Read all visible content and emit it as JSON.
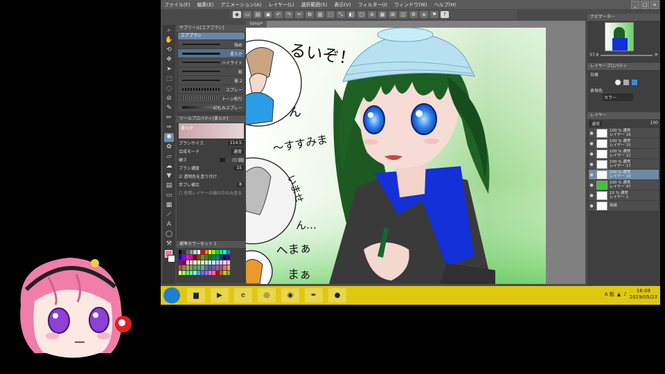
{
  "menu": [
    "ファイル(F)",
    "編集(E)",
    "アニメーション(A)",
    "レイヤー(L)",
    "選択範囲(S)",
    "表示(V)",
    "フィルター(I)",
    "ウィンドウ(W)",
    "ヘルプ(H)"
  ],
  "window_controls": [
    "_",
    "□",
    "×"
  ],
  "subtool": {
    "header": "サブツール[エアブラシ]",
    "tab": "エアブラシ",
    "brushes": [
      "強め",
      "柔らか",
      "ハイライト",
      "影",
      "影 2",
      "スプレー",
      "トーン削り",
      "にじみスプレー"
    ],
    "selected_brush": 1
  },
  "tool_property": {
    "header": "ツールプロパティ[柔らか]",
    "name_label": "柔らか",
    "rows": [
      {
        "label": "ブラシサイズ",
        "value": "114.5"
      },
      {
        "label": "合成モード",
        "value": "通常"
      },
      {
        "label": "硬さ",
        "value": ""
      },
      {
        "label": "ブラシ濃度",
        "value": "15"
      },
      {
        "label": "透明色を塗り付け",
        "value": ""
      },
      {
        "label": "手ブレ補正",
        "value": "8"
      },
      {
        "label": "参照レイヤーの線の中のみ塗る",
        "value": ""
      }
    ]
  },
  "color_set": {
    "header": "標準カラーセット 1"
  },
  "canvas_tab": "kimo*",
  "canvas_text": [
    "るいぞ！",
    "ん",
    "〜すすみま",
    "いませ",
    "ん…",
    "へまぁ",
    "まぁ"
  ],
  "navigator": {
    "header": "ナビゲーター",
    "zoom": "37.6"
  },
  "layer_property": {
    "header": "レイヤープロパティ",
    "effect_label": "効果",
    "expression_label": "表現色",
    "expression_value": "カラー"
  },
  "layers": {
    "header": "レイヤー",
    "blend_mode": "通常",
    "opacity": "100",
    "items": [
      {
        "line1": "100 % 通常",
        "line2": "レイヤー 16"
      },
      {
        "line1": "100 % 通常",
        "line2": "レイヤー 15"
      },
      {
        "line1": "100 % 通常",
        "line2": "レイヤー 12"
      },
      {
        "line1": "100 % 通常",
        "line2": "レイヤー 17"
      },
      {
        "line1": "100 % 通常",
        "line2": "レイヤー 18"
      },
      {
        "line1": "100 % 通常",
        "line2": "レイヤー 47"
      },
      {
        "line1": "15 % 通常",
        "line2": "レイヤー 1"
      },
      {
        "line1": "",
        "line2": "用紙"
      }
    ],
    "selected": 4
  },
  "taskbar": {
    "apps": [
      "folder-icon",
      "media-player-icon",
      "ie-icon",
      "app-icon",
      "chrome-icon",
      "clip-studio-icon",
      "recorder-icon"
    ],
    "tray_lang": "A 般",
    "time": "16:09",
    "date": "2019/05/23"
  },
  "colors": {
    "menubar": "#5a5a5a",
    "panel": "#3f3f3f",
    "selection": "#6f8aa6",
    "taskbar": "#e0c810",
    "hair": "#1f5e25",
    "jacket": "#1430d8",
    "hat": "#a9d8e8"
  }
}
